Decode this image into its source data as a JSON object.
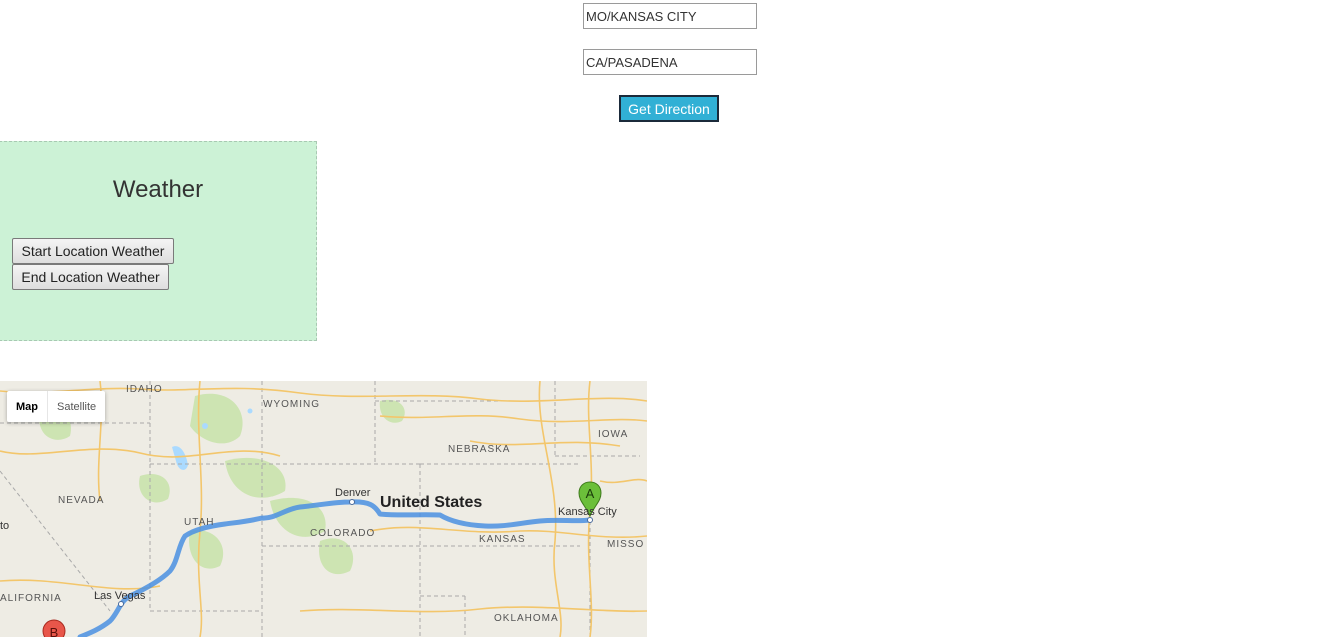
{
  "form": {
    "start_value": "MO/KANSAS CITY",
    "end_value": "CA/PASADENA",
    "submit_label": "Get Direction"
  },
  "weather": {
    "title": "Weather",
    "start_button": "Start Location Weather",
    "end_button": "End Location Weather"
  },
  "map": {
    "type_buttons": [
      "Map",
      "Satellite"
    ],
    "active_type": "Map",
    "labels": {
      "idaho": "IDAHO",
      "wyoming": "WYOMING",
      "iowa": "IOWA",
      "nebraska": "NEBRASKA",
      "nevada": "NEVADA",
      "denver": "Denver",
      "united_states": "United States",
      "kansas_city": "Kansas City",
      "utah": "UTAH",
      "colorado": "COLORADO",
      "kansas": "KANSAS",
      "missouri": "MISSO",
      "las_vegas": "Las Vegas",
      "california": "ALIFORNIA",
      "oklahoma": "OKLAHOMA",
      "to": "to"
    },
    "markers": {
      "start": "A",
      "end": "B"
    },
    "colors": {
      "land": "#eeece4",
      "route": "#4a90e2",
      "park": "#cde4b2",
      "road": "#f3c66b",
      "marker_start": "#6bbf3a",
      "marker_end": "#e8564a"
    }
  }
}
